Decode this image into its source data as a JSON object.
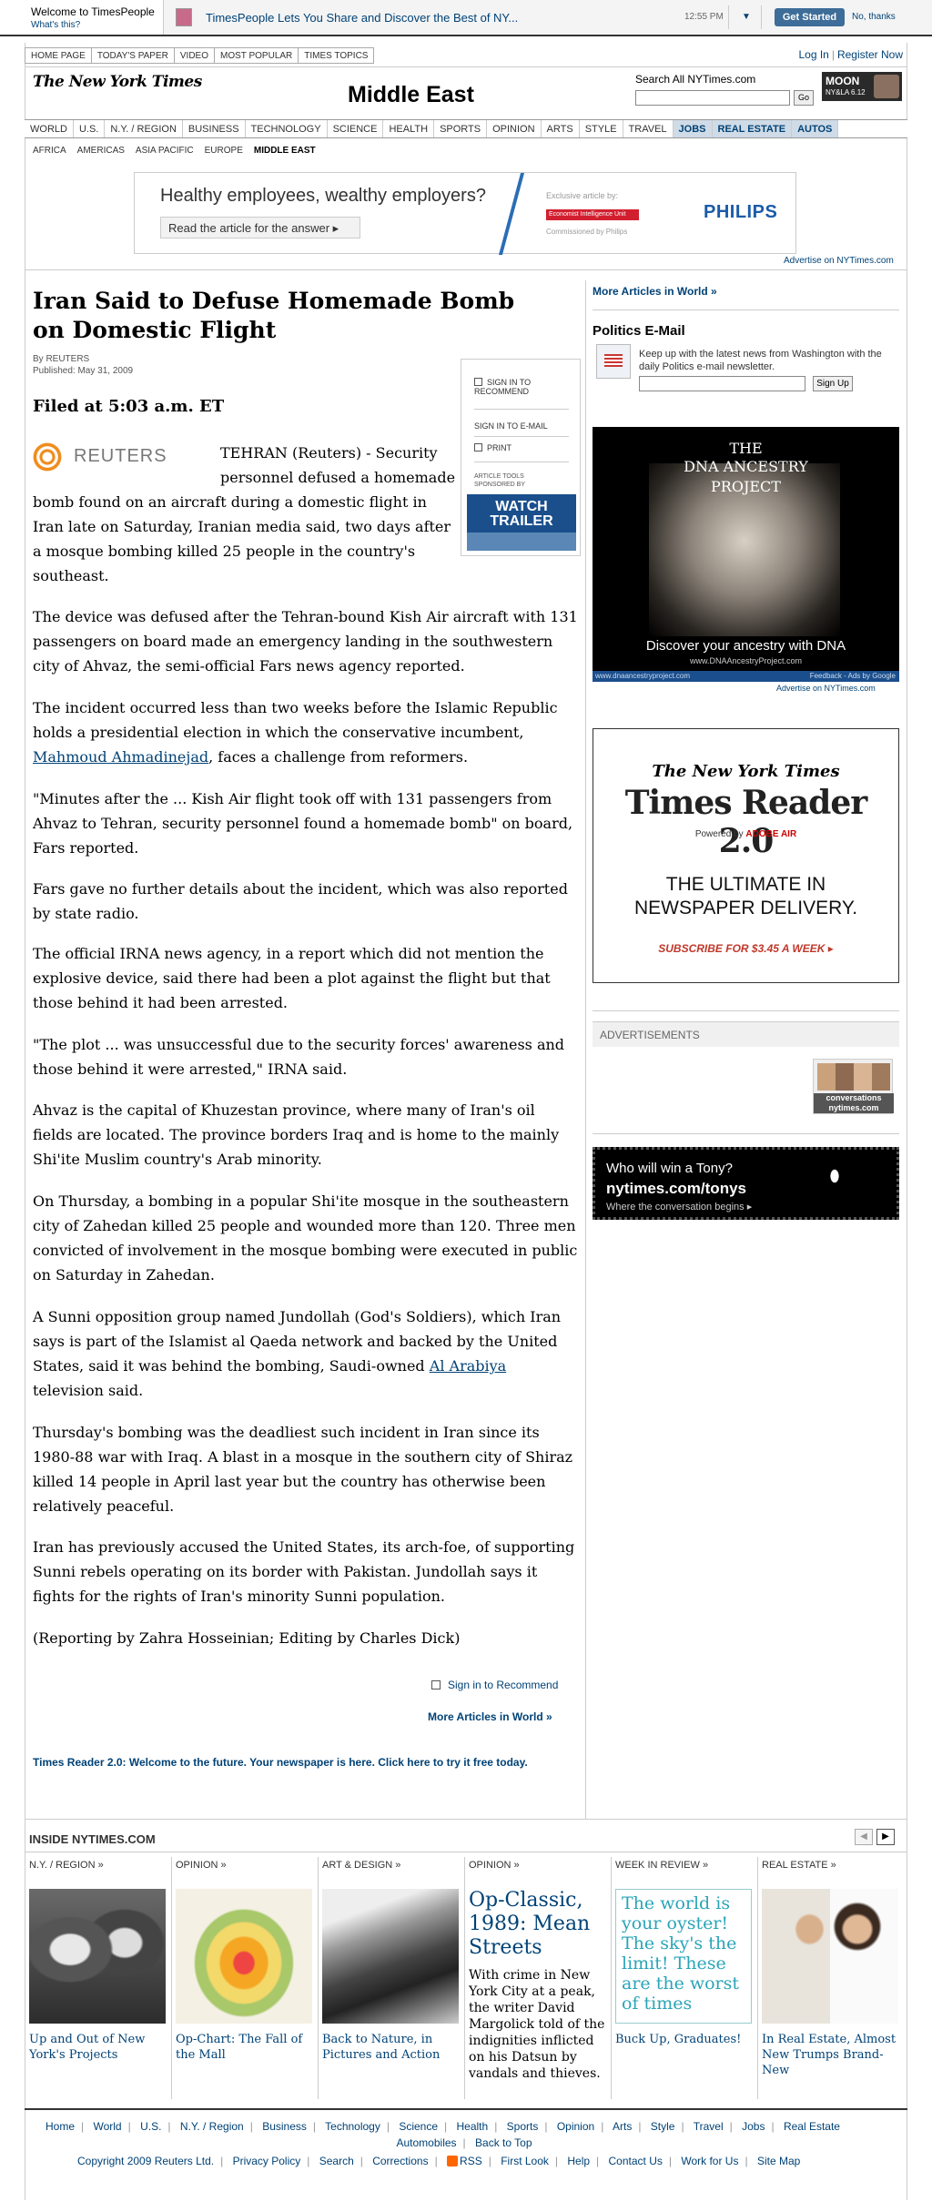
{
  "timespeople": {
    "welcome": "Welcome to TimesPeople",
    "whats_this": "What's this?",
    "headline": "TimesPeople Lets You Share and Discover the Best of NY...",
    "time": "12:55 PM",
    "get_started": "Get Started",
    "no_thanks": "No, thanks"
  },
  "top_links": [
    "HOME PAGE",
    "TODAY'S PAPER",
    "VIDEO",
    "MOST POPULAR",
    "TIMES TOPICS"
  ],
  "account": {
    "login": "Log In",
    "register": "Register Now"
  },
  "header": {
    "logo": "The New York Times",
    "section": "Middle East",
    "search_label": "Search All NYTimes.com",
    "search_go": "Go",
    "moon_ad_title": "MOON",
    "moon_ad_sub": "NY&LA 6.12"
  },
  "main_nav": [
    "WORLD",
    "U.S.",
    "N.Y. / REGION",
    "BUSINESS",
    "TECHNOLOGY",
    "SCIENCE",
    "HEALTH",
    "SPORTS",
    "OPINION",
    "ARTS",
    "STYLE",
    "TRAVEL",
    "JOBS",
    "REAL ESTATE",
    "AUTOS"
  ],
  "sub_nav": [
    "AFRICA",
    "AMERICAS",
    "ASIA PACIFIC",
    "EUROPE",
    "MIDDLE EAST"
  ],
  "top_ad": {
    "headline": "Healthy employees, wealthy employers?",
    "button": "Read the article for the answer ▸",
    "exclusive": "Exclusive article by:",
    "eiu": "Economist Intelligence Unit",
    "commissioned": "Commissioned by Philips",
    "brand": "PHILIPS"
  },
  "advertise_link": "Advertise on NYTimes.com",
  "article": {
    "headline": "Iran Said to Defuse Homemade Bomb on Domestic Flight",
    "byline": "By REUTERS",
    "published": "Published: May 31, 2009",
    "filed": "Filed at 5:03 a.m. ET",
    "reuters": "REUTERS",
    "p1_part1": "TEHRAN (Reuters) - Security personnel defused a homemade",
    "p1_part2": "bomb found on an aircraft during a domestic flight in Iran late on Saturday, Iranian media said, two days after a mosque bombing killed 25 people in the country's southeast.",
    "p2": "The device was defused after the Tehran-bound Kish Air aircraft with 131 passengers on board made an emergency landing in the southwestern city of Ahvaz, the semi-official Fars news agency reported.",
    "p3_pre": "The incident occurred less than two weeks before the Islamic Republic holds a presidential election in which the conservative incumbent,",
    "p3_link": "Mahmoud Ahmadinejad",
    "p3_post": ", faces a challenge from reformers.",
    "p4": "\"Minutes after the ... Kish Air flight took off with 131 passengers from Ahvaz to Tehran, security personnel found a homemade bomb\" on board, Fars reported.",
    "p5": "Fars gave no further details about the incident, which was also reported by state radio.",
    "p6": "The official IRNA news agency, in a report which did not mention the explosive device, said there had been a plot against the flight but that those behind it had been arrested.",
    "p7": "\"The plot ... was unsuccessful due to the security forces' awareness and those behind it were arrested,\" IRNA said.",
    "p8": "Ahvaz is the capital of Khuzestan province, where many of Iran's oil fields are located. The province borders Iraq and is home to the mainly Shi'ite Muslim country's Arab minority.",
    "p9": "On Thursday, a bombing in a popular Shi'ite mosque in the southeastern city of Zahedan killed 25 people and wounded more than 120. Three men convicted of involvement in the mosque bombing were executed in public on Saturday in Zahedan.",
    "p10_pre": "A Sunni opposition group named Jundollah (God's Soldiers), which Iran says is part of the Islamist al Qaeda network and backed by the United States, said it was behind the bombing, Saudi-owned",
    "p10_link": "Al Arabiya",
    "p10_post": "television said.",
    "p11": "Thursday's bombing was the deadliest such incident in Iran since its 1980-88 war with Iraq. A blast in a mosque in the southern city of Shiraz killed 14 people in April last year but the country has otherwise been relatively peaceful.",
    "p12": "Iran has previously accused the United States, its arch-foe, of supporting Sunni rebels operating on its border with Pakistan. Jundollah says it fights for the rights of Iran's minority Sunni population.",
    "p13": "(Reporting by Zahra Hosseinian; Editing by Charles Dick)",
    "sign_in_recommend": "Sign in to Recommend",
    "more_articles": "More Articles in World »",
    "times_reader_promo": "Times Reader 2.0: Welcome to the future. Your newspaper is here. Click here to try it free today."
  },
  "tools": {
    "recommend": "SIGN IN TO RECOMMEND",
    "email": "SIGN IN TO E-MAIL",
    "print": "PRINT",
    "sponsored": "ARTICLE TOOLS SPONSORED BY",
    "watch": "WATCH",
    "trailer": "TRAILER"
  },
  "sidebar": {
    "more_articles": "More Articles in World »",
    "politics_title": "Politics E-Mail",
    "politics_desc": "Keep up with the latest news from Washington with the daily Politics e-mail newsletter.",
    "sign_up": "Sign Up",
    "dna_line1": "THE",
    "dna_line2": "DNA ANCESTRY",
    "dna_line3": "PROJECT",
    "dna_tagline": "Discover your ancestry with DNA",
    "dna_url": "www.DNAAncestryProject.com",
    "dna_bar_left": "www.dnaancestryproject.com",
    "dna_bar_right": "Feedback - Ads by Google",
    "tr_logo": "The New York Times",
    "tr_name": "Times Reader 2.0",
    "tr_powered": "Powered by",
    "tr_air": "ADOBE AIR",
    "tr_ultimate": "THE ULTIMATE IN NEWSPAPER DELIVERY.",
    "tr_subscribe": "SUBSCRIBE FOR $3.45 A WEEK ▸",
    "advertisements": "ADVERTISEMENTS",
    "conv_ad": "conversations nytimes.com",
    "tony_q": "Who will win a Tony?",
    "tony_url": "nytimes.com/tonys",
    "tony_tag": "Where the conversation begins ▸"
  },
  "inside": {
    "title": "INSIDE NYTIMES.COM",
    "prev": "◀",
    "next": "▶",
    "items": [
      {
        "category": "N.Y. / REGION »",
        "caption": "Up and Out of New York's Projects"
      },
      {
        "category": "OPINION »",
        "caption": "Op-Chart: The Fall of the Mall"
      },
      {
        "category": "ART & DESIGN »",
        "caption": "Back to Nature, in Pictures and Action"
      },
      {
        "category": "OPINION »",
        "headline": "Op-Classic, 1989: Mean Streets",
        "body": "With crime in New York City at a peak, the writer David Margolick told of the indignities inflicted on his Datsun by vandals and thieves."
      },
      {
        "category": "WEEK IN REVIEW »",
        "box": "The world is your oyster! The sky's the limit! These are the worst of times",
        "caption": "Buck Up, Graduates!"
      },
      {
        "category": "REAL ESTATE »",
        "caption": "In Real Estate, Almost New Trumps Brand-New"
      }
    ]
  },
  "footer": {
    "nav": [
      "Home",
      "World",
      "U.S.",
      "N.Y. / Region",
      "Business",
      "Technology",
      "Science",
      "Health",
      "Sports",
      "Opinion",
      "Arts",
      "Style",
      "Travel",
      "Jobs",
      "Real Estate",
      "Automobiles",
      "Back to Top"
    ],
    "links": [
      "Copyright 2009 Reuters Ltd.",
      "Privacy Policy",
      "Search",
      "Corrections",
      "RSS",
      "First Look",
      "Help",
      "Contact Us",
      "Work for Us",
      "Site Map"
    ]
  }
}
